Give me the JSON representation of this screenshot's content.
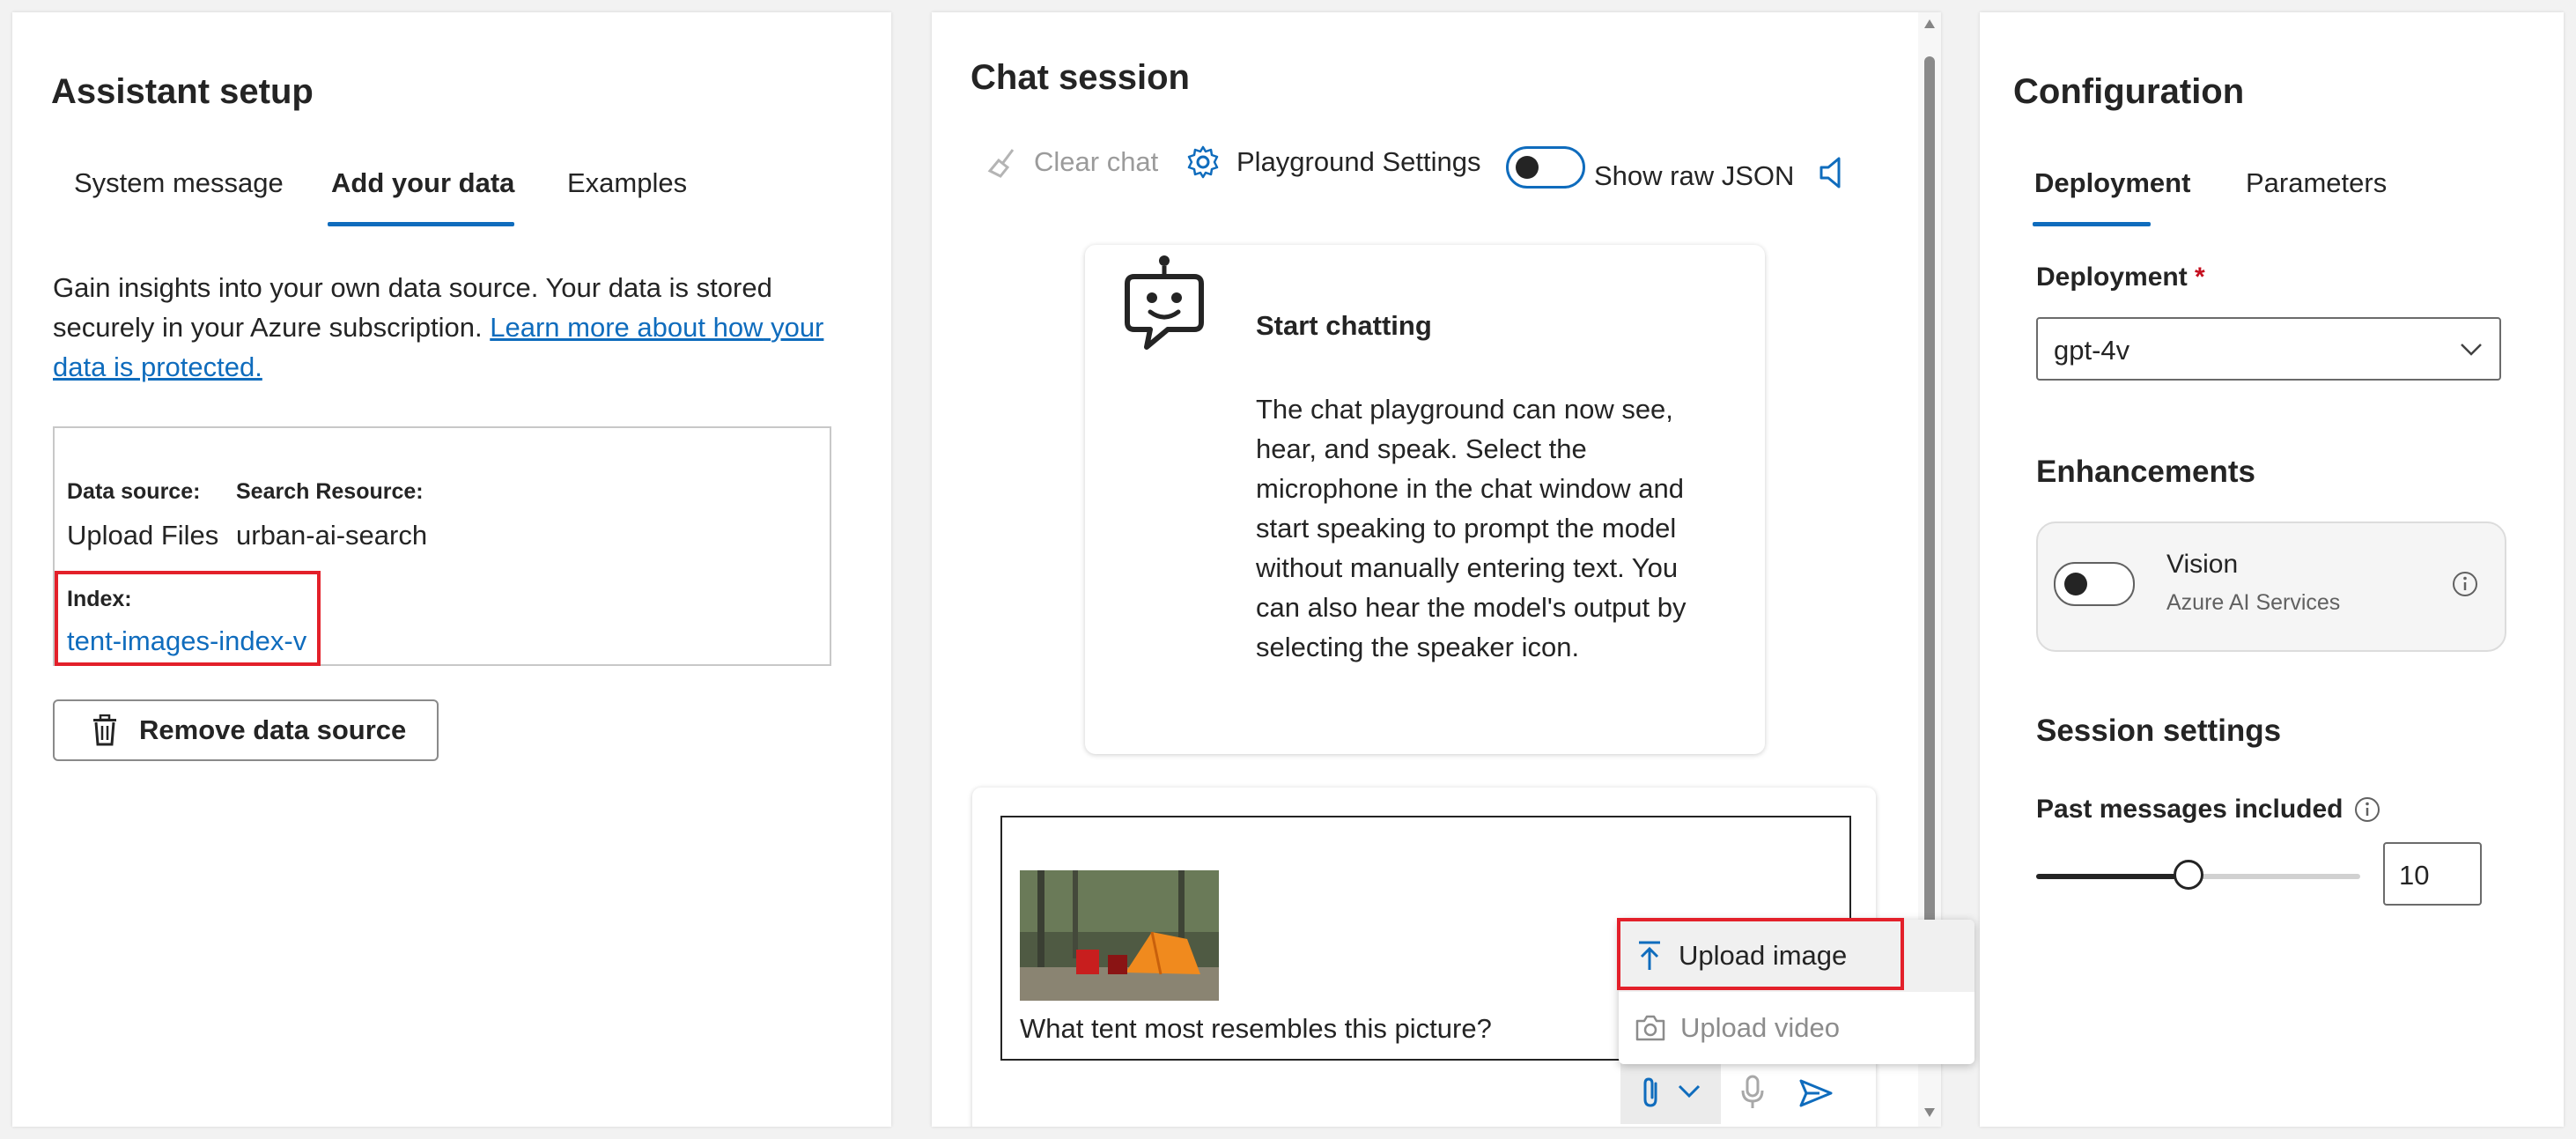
{
  "assistant_setup": {
    "title": "Assistant setup",
    "tabs": [
      {
        "label": "System message",
        "active": false
      },
      {
        "label": "Add your data",
        "active": true
      },
      {
        "label": "Examples",
        "active": false
      }
    ],
    "description_prefix": "Gain insights into your own data source. Your data is stored securely in your Azure subscription.",
    "learn_more_line1": "Learn more about how",
    "learn_more_line2": "your data is protected.",
    "data_source": {
      "source_label": "Data source:",
      "source_value": "Upload Files",
      "search_label": "Search Resource:",
      "search_value": "urban-ai-search",
      "index_label": "Index:",
      "index_value": "tent-images-index-v"
    },
    "remove_button": "Remove data source"
  },
  "chat_session": {
    "title": "Chat session",
    "toolbar": {
      "clear_chat": "Clear chat",
      "playground_settings": "Playground Settings",
      "show_raw_json": "Show raw JSON",
      "raw_json_enabled": false
    },
    "start_card": {
      "title": "Start chatting",
      "body": "The chat playground can now see, hear, and speak. Select the microphone in the chat window and start speaking to prompt the model without manually entering text. You can also hear the model's output by selecting the speaker icon."
    },
    "input": {
      "text": "What tent most resembles this picture?"
    },
    "attach_menu": {
      "items": [
        {
          "label": "Upload image",
          "icon": "upload-icon"
        },
        {
          "label": "Upload video",
          "icon": "camera-icon"
        }
      ]
    }
  },
  "configuration": {
    "title": "Configuration",
    "tabs": [
      {
        "label": "Deployment",
        "active": true
      },
      {
        "label": "Parameters",
        "active": false
      }
    ],
    "deployment_label": "Deployment",
    "required_marker": "*",
    "deployment_value": "gpt-4v",
    "enhancements_title": "Enhancements",
    "vision": {
      "label": "Vision",
      "sublabel": "Azure AI Services",
      "enabled": false
    },
    "session_title": "Session settings",
    "past_messages_label": "Past messages included",
    "past_messages_value": "10",
    "past_messages_fraction": 0.47
  },
  "colors": {
    "accent": "#0f6cbd",
    "highlight": "#e3202a",
    "text": "#242424",
    "muted": "#616161"
  }
}
